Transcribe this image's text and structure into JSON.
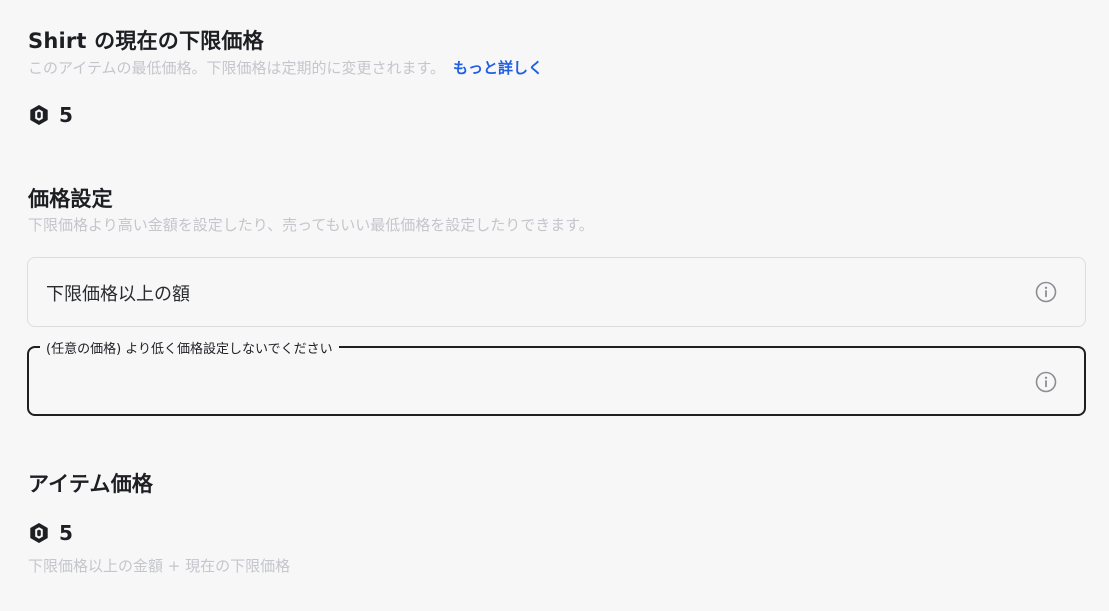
{
  "floor_price_section": {
    "title": "Shirt の現在の下限価格",
    "description": "このアイテムの最低価格。下限価格は定期的に変更されます。",
    "learn_more_link": "もっと詳しく",
    "value": "5",
    "currency_icon": "robux-icon"
  },
  "price_settings_section": {
    "title": "価格設定",
    "description": "下限価格より高い金額を設定したり、売ってもいい最低価格を設定したりできます。",
    "above_floor_field": {
      "placeholder": "下限価格以上の額",
      "value": "",
      "icon": "info-icon"
    },
    "min_price_field": {
      "label": "(任意の価格) より低く価格設定しないでください",
      "value": "",
      "icon": "info-icon"
    }
  },
  "item_price_section": {
    "title": "アイテム価格",
    "value": "5",
    "currency_icon": "robux-icon",
    "formula": "下限価格以上の金額 + 現在の下限価格"
  },
  "colors": {
    "background": "#f7f7f8",
    "link": "#1e5fe6",
    "muted_text": "#c5c6cc",
    "border_active": "#1f1f22",
    "border_default": "#dcdde0"
  }
}
